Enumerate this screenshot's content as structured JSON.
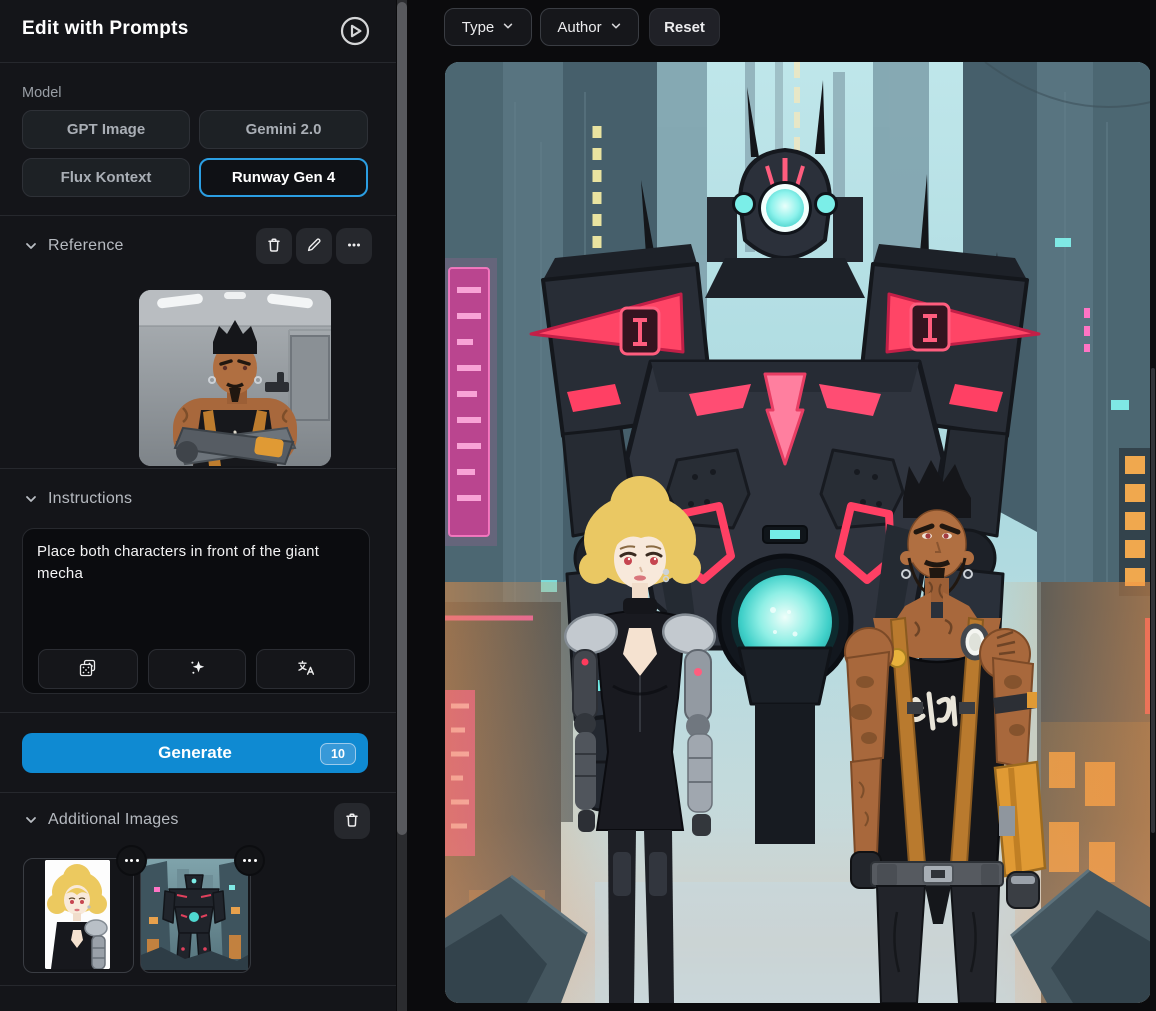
{
  "app": {
    "title": "Edit with Prompts"
  },
  "sidebar": {
    "header": {
      "title": "Edit with Prompts"
    },
    "model": {
      "label": "Model",
      "options": [
        {
          "label": "GPT Image",
          "selected": false
        },
        {
          "label": "Gemini 2.0",
          "selected": false
        },
        {
          "label": "Flux Kontext",
          "selected": false
        },
        {
          "label": "Runway Gen 4",
          "selected": true
        }
      ]
    },
    "reference": {
      "label": "Reference",
      "image_description": "Muscular man with dark mohawk, beard, tattoos and crossed cybernetic arms wearing a black tank top in a white room"
    },
    "instructions": {
      "label": "Instructions",
      "value": "Place both characters in front of the giant mecha"
    },
    "generate": {
      "label": "Generate",
      "credits": "10"
    },
    "additional_images": {
      "label": "Additional Images",
      "items": [
        {
          "description": "Blonde woman in black top with silver cybernetic arm on white background"
        },
        {
          "description": "Black mecha with red accents standing in a neon cyberpunk street"
        }
      ]
    }
  },
  "main": {
    "filters": {
      "type": "Type",
      "author": "Author",
      "reset": "Reset"
    },
    "image_description": "Giant black mecha with pink accents and glowing teal chest core towering behind a blonde cyborg woman and a tattooed muscular man in a teal neon cyberpunk city"
  },
  "icons": {
    "play-circle": "circled play triangle",
    "chevron-down": "⌄",
    "trash": "trash can outline",
    "pencil": "✎",
    "ellipsis": "•••",
    "dice": "pair of dice",
    "sparkles": "✦",
    "translate": "文A"
  },
  "colors": {
    "accent_blue": "#0f8ad2",
    "selected_border": "#2b9ee2",
    "sidebar_bg": "#141519",
    "main_bg": "#0b0b0d",
    "mecha_pink": "#ff4566",
    "core_teal": "#58dfd6"
  }
}
